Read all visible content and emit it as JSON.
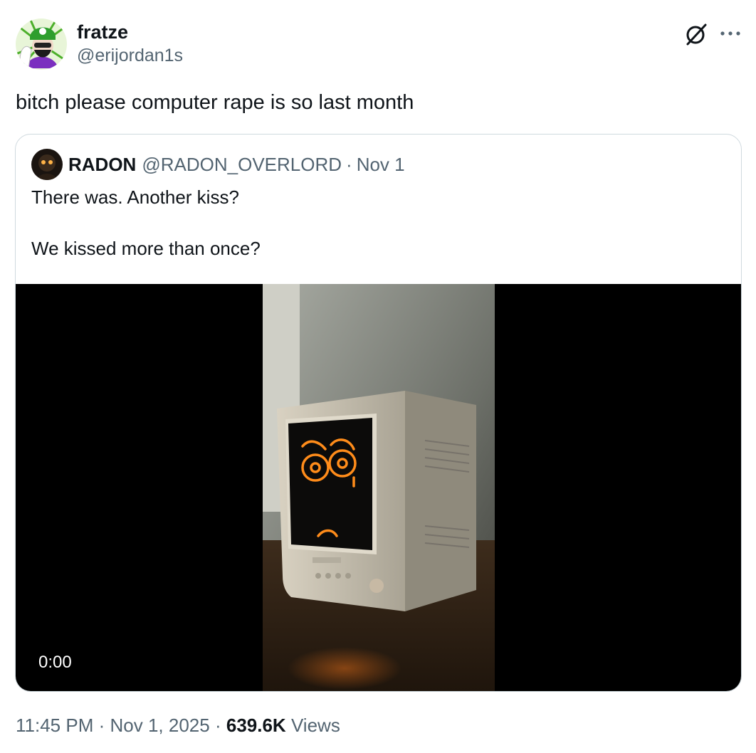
{
  "author": {
    "display_name": "fratze",
    "handle": "@erijordan1s"
  },
  "tweet": {
    "text": "bitch please computer rape is so last month"
  },
  "quoted": {
    "display_name": "RADON",
    "handle": "@RADON_OVERLORD",
    "separator": "·",
    "date": "Nov 1",
    "lines": [
      "There was. Another kiss?",
      "We kissed more than once?"
    ],
    "video": {
      "timecode": "0:00"
    }
  },
  "meta": {
    "time": "11:45 PM",
    "sep1": "·",
    "date": "Nov 1, 2025",
    "sep2": "·",
    "views_count": "639.6K",
    "views_label": "Views"
  },
  "icons": {
    "grok": "grok-icon",
    "more": "more-icon"
  },
  "colors": {
    "text_primary": "#0f1419",
    "text_secondary": "#536471",
    "border": "#cfd9de",
    "screen_glow": "#ff8c1a"
  }
}
